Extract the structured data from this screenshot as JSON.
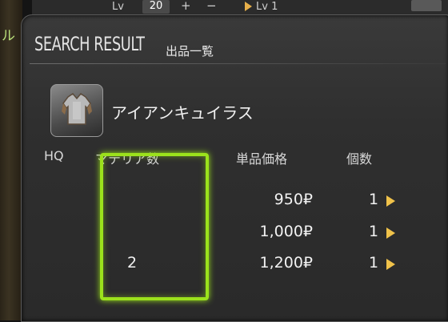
{
  "background": {
    "left_text": "ル"
  },
  "top_strip": {
    "lv_label": "Lv",
    "lv_value": "20",
    "plus": "+",
    "minus": "−",
    "lv_label2": "Lv 1"
  },
  "window": {
    "title": "SEARCH RESULT",
    "subtitle": "出品一覧",
    "item_name": "アイアンキュイラス",
    "item_icon": "cuirass-armor-icon",
    "columns": {
      "hq": "HQ",
      "materia": "マテリア数",
      "unit_price": "単品価格",
      "quantity": "個数"
    },
    "rows": [
      {
        "materia": "",
        "price": "950₽",
        "quantity": "1"
      },
      {
        "materia": "",
        "price": "1,000₽",
        "quantity": "1"
      },
      {
        "materia": "2",
        "price": "1,200₽",
        "quantity": "1"
      }
    ]
  },
  "colors": {
    "highlight": "#9be21c",
    "arrow": "#f0c24a"
  }
}
